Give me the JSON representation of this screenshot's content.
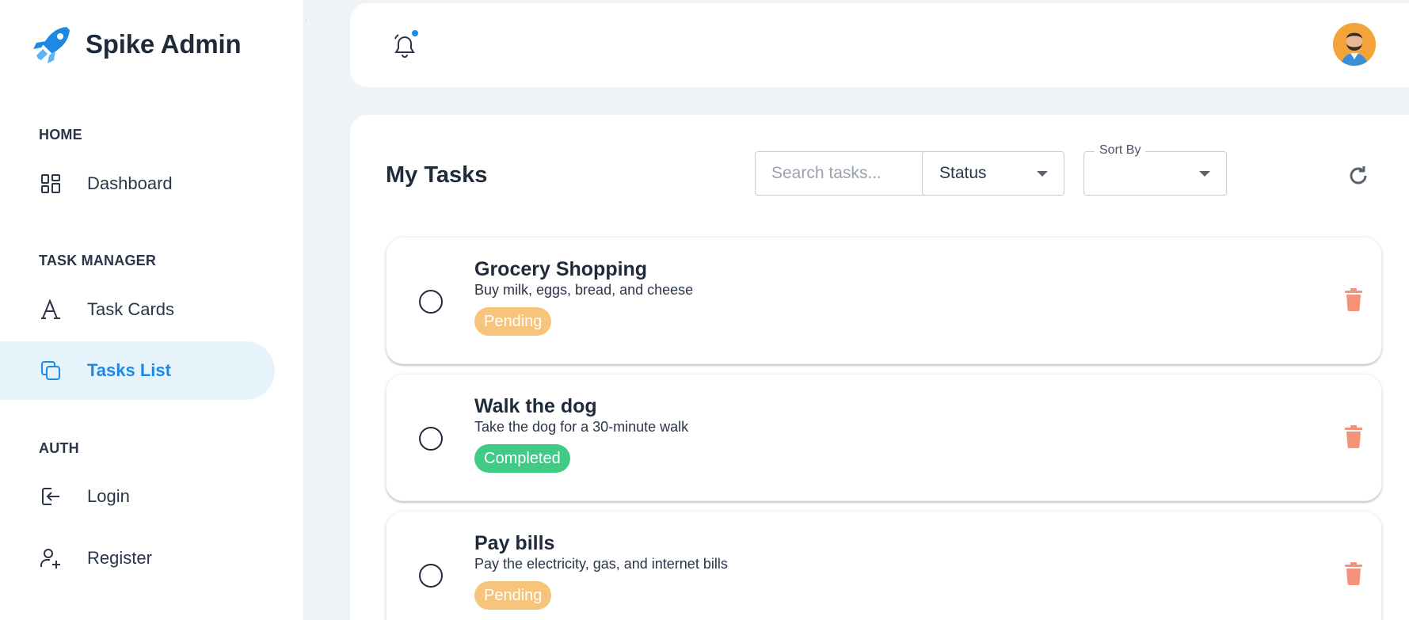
{
  "brand": {
    "name": "Spike Admin"
  },
  "colors": {
    "accent": "#1e88e5",
    "active_bg": "#e6f3fb",
    "pending": "#f6c47b",
    "completed": "#3fcb86",
    "trash": "#f4937a"
  },
  "sidebar": {
    "sections": [
      {
        "title": "HOME"
      },
      {
        "title": "TASK MANAGER"
      },
      {
        "title": "AUTH"
      }
    ],
    "items": [
      {
        "label": "Dashboard",
        "icon": "dashboard-icon"
      },
      {
        "label": "Task Cards",
        "icon": "typography-icon"
      },
      {
        "label": "Tasks List",
        "icon": "copy-icon",
        "active": true
      },
      {
        "label": "Login",
        "icon": "login-icon"
      },
      {
        "label": "Register",
        "icon": "user-plus-icon"
      }
    ]
  },
  "topbar": {
    "notifications_icon": "bell-icon",
    "avatar": "user-avatar"
  },
  "main": {
    "title": "My Tasks",
    "search": {
      "placeholder": "Search tasks...",
      "value": ""
    },
    "status_filter": {
      "value": "Status"
    },
    "sort_by": {
      "label": "Sort By",
      "value": ""
    },
    "refresh_icon": "refresh-icon"
  },
  "tasks": [
    {
      "title": "Grocery Shopping",
      "description": "Buy milk, eggs, bread, and cheese",
      "status": "Pending"
    },
    {
      "title": "Walk the dog",
      "description": "Take the dog for a 30-minute walk",
      "status": "Completed"
    },
    {
      "title": "Pay bills",
      "description": "Pay the electricity, gas, and internet bills",
      "status": "Pending"
    }
  ]
}
